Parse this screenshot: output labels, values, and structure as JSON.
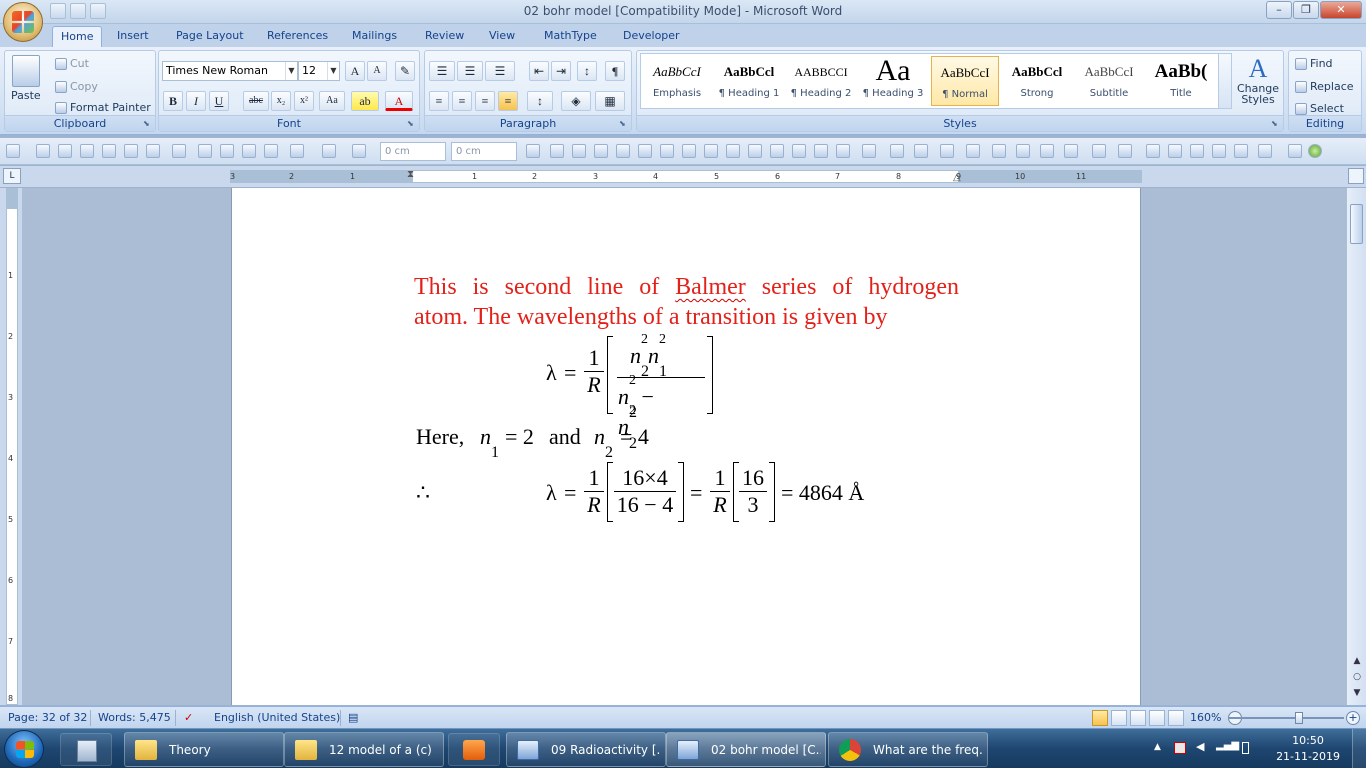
{
  "window": {
    "title": "02  bohr model [Compatibility Mode] - Microsoft Word",
    "minimize": "–",
    "restore": "❐",
    "close": "✕"
  },
  "tabs": [
    "Home",
    "Insert",
    "Page Layout",
    "References",
    "Mailings",
    "Review",
    "View",
    "MathType",
    "Developer"
  ],
  "ribbon": {
    "clipboard": {
      "label": "Clipboard",
      "paste": "Paste",
      "cut": "Cut",
      "copy": "Copy",
      "format_painter": "Format Painter"
    },
    "font": {
      "label": "Font",
      "family": "Times New Roman",
      "size": "12"
    },
    "paragraph": {
      "label": "Paragraph"
    },
    "styles": {
      "label": "Styles",
      "items": [
        {
          "preview": "AaBbCcI",
          "name": "Emphasis"
        },
        {
          "preview": "AaBbCcl",
          "name": "¶ Heading 1"
        },
        {
          "preview": "AABBCCI",
          "name": "¶ Heading 2"
        },
        {
          "preview": "Aa",
          "name": "¶ Heading 3"
        },
        {
          "preview": "AaBbCcI",
          "name": "¶ Normal"
        },
        {
          "preview": "AaBbCcl",
          "name": "Strong"
        },
        {
          "preview": "AaBbCcI",
          "name": "Subtitle"
        },
        {
          "preview": "AaBb(",
          "name": "Title"
        }
      ],
      "change_styles": "Change Styles"
    },
    "editing": {
      "label": "Editing",
      "find": "Find",
      "replace": "Replace",
      "select": "Select"
    }
  },
  "toolbar2": {
    "spin1": "0 cm",
    "spin2": "0 cm"
  },
  "ruler": {
    "left_marks": [
      "3",
      "2",
      "1"
    ],
    "right_marks": [
      "1",
      "2",
      "3",
      "4",
      "5",
      "6",
      "7",
      "8",
      "9",
      "10",
      "11"
    ],
    "vertical_marks": [
      "1",
      "2",
      "3",
      "4",
      "5",
      "6",
      "7",
      "8"
    ]
  },
  "document": {
    "line1_a": "This is second line of ",
    "line1_word": "Balmer",
    "line1_b": " series of hydrogen",
    "line2": "atom. The wavelengths of a transition is given by",
    "formula": {
      "lambda": "λ",
      "eq": "=",
      "one": "1",
      "R": "R",
      "n2": "n",
      "sub2": "2",
      "sub1": "1",
      "sq": "2",
      "minus": "−"
    },
    "here_line": {
      "here": "Here,",
      "n": "n",
      "s1": "1",
      "eq2": "= 2",
      "and": "and",
      "s2": "2",
      "eq4": "= 4"
    },
    "calc": {
      "therefore": "∴",
      "lambda": "λ",
      "eq": "=",
      "one": "1",
      "R": "R",
      "num1": "16×4",
      "den1": "16 − 4",
      "eq2": "=",
      "num2": "16",
      "den2": "3",
      "result": "= 4864 Å"
    }
  },
  "status": {
    "page": "Page: 32 of 32",
    "words": "Words: 5,475",
    "language": "English (United States)",
    "zoom": "160%"
  },
  "taskbar": {
    "items": [
      {
        "label": "Theory",
        "icon": "folder-icon"
      },
      {
        "label": "12 model of a (c)",
        "icon": "folder-icon"
      },
      {
        "label": "",
        "icon": "media-player-icon"
      },
      {
        "label": "09 Radioactivity [...",
        "icon": "word-icon"
      },
      {
        "label": "02  bohr model [C...",
        "icon": "word-icon"
      },
      {
        "label": "What are the freq...",
        "icon": "chrome-icon"
      }
    ],
    "time": "10:50",
    "date": "21-11-2019"
  },
  "colors": {
    "doc_text_red": "#e32119",
    "ribbon_blue": "#15428b"
  }
}
